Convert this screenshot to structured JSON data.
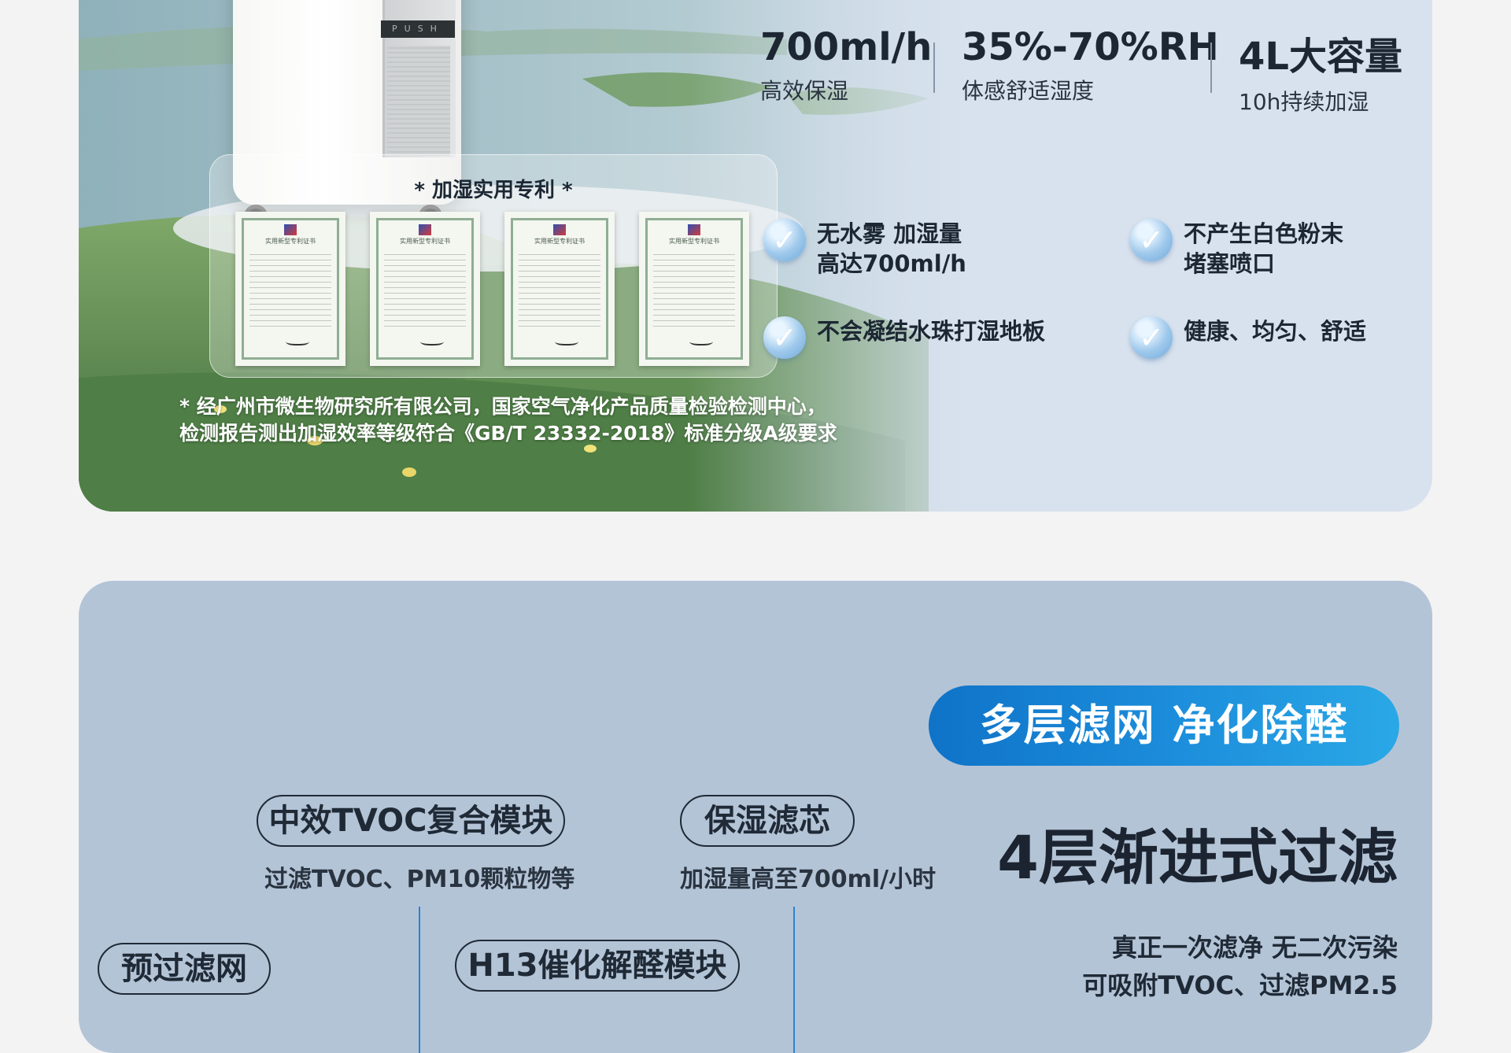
{
  "section1": {
    "device": {
      "push_label": "PUSH"
    },
    "patent": {
      "title": "* 加湿实用专利 *",
      "certificate_heading": "实用新型专利证书",
      "certificate_count": 4
    },
    "note": {
      "line1": "* 经广州市微生物研究所有限公司，国家空气净化产品质量检验检测中心，",
      "line2": " 检测报告测出加湿效率等级符合《GB/T 23332-2018》标准分级A级要求"
    },
    "stats": [
      {
        "value": "700ml/h",
        "label": "高效保湿"
      },
      {
        "value": "35%-70%RH",
        "label": "体感舒适湿度"
      },
      {
        "value": "4L大容量",
        "label": "10h持续加湿"
      }
    ],
    "features": [
      {
        "text": "无水雾 加湿量\n高达700ml/h",
        "icon": "check-icon"
      },
      {
        "text": "不产生白色粉末\n堵塞喷口",
        "icon": "check-icon"
      },
      {
        "text": "不会凝结水珠打湿地板",
        "icon": "check-icon"
      },
      {
        "text": "健康、均匀、舒适",
        "icon": "check-icon"
      }
    ]
  },
  "section2": {
    "banner": "多层滤网 净化除醛",
    "headline": "4层渐进式过滤",
    "sub_line1": "真正一次滤净 无二次污染",
    "sub_line2": "可吸附TVOC、过滤PM2.5",
    "modules": [
      {
        "label": "中效TVOC复合模块",
        "caption": "过滤TVOC、PM10颗粒物等"
      },
      {
        "label": "保湿滤芯",
        "caption": "加湿量高至700ml/小时"
      },
      {
        "label": "预过滤网"
      },
      {
        "label": "H13催化解醛模块"
      }
    ]
  },
  "colors": {
    "accent": "#1d8fdc",
    "line": "#2d82d0",
    "text": "#1c2733"
  }
}
